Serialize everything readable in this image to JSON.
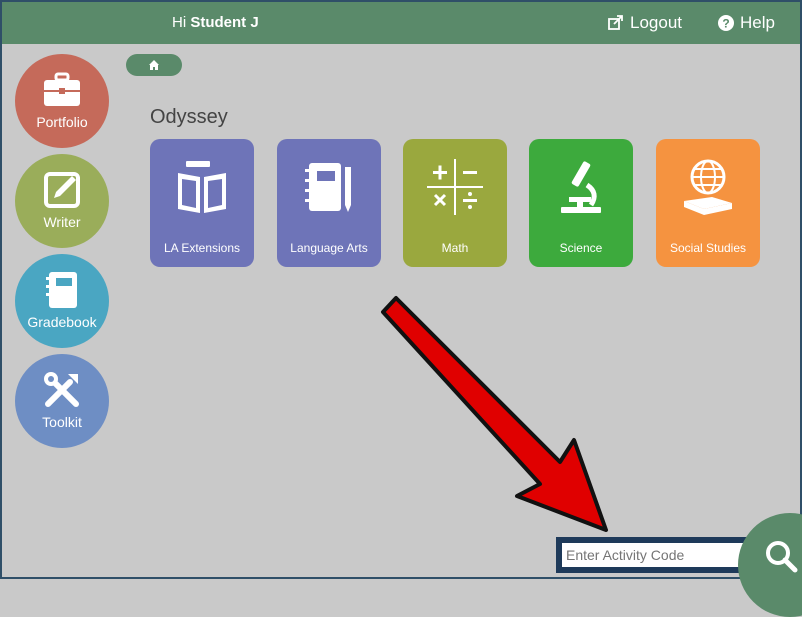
{
  "header": {
    "greeting_prefix": "Hi",
    "user_name": "Student J",
    "logout_label": "Logout",
    "help_label": "Help"
  },
  "sidebar": {
    "items": [
      {
        "label": "Portfolio",
        "icon": "briefcase-icon",
        "color": "#c56a5a"
      },
      {
        "label": "Writer",
        "icon": "edit-icon",
        "color": "#9aad5a"
      },
      {
        "label": "Gradebook",
        "icon": "notebook-icon",
        "color": "#4aa6c2"
      },
      {
        "label": "Toolkit",
        "icon": "tools-icon",
        "color": "#6e8ec4"
      }
    ]
  },
  "breadcrumb": {
    "icon": "home-icon"
  },
  "main": {
    "section_title": "Odyssey",
    "tiles": [
      {
        "label": "LA Extensions",
        "icon": "open-book-icon",
        "color": "#6e74b8"
      },
      {
        "label": "Language Arts",
        "icon": "notebook-pencil-icon",
        "color": "#6e74b8"
      },
      {
        "label": "Math",
        "icon": "math-operators-icon",
        "color": "#9aa83e"
      },
      {
        "label": "Science",
        "icon": "microscope-icon",
        "color": "#3daa3d"
      },
      {
        "label": "Social Studies",
        "icon": "globe-book-icon",
        "color": "#f59340"
      }
    ]
  },
  "activity_code": {
    "placeholder": "Enter Activity Code",
    "value": ""
  },
  "colors": {
    "header": "#5a8a6a",
    "background": "#c9c9c9",
    "arrow": "#e00000"
  }
}
